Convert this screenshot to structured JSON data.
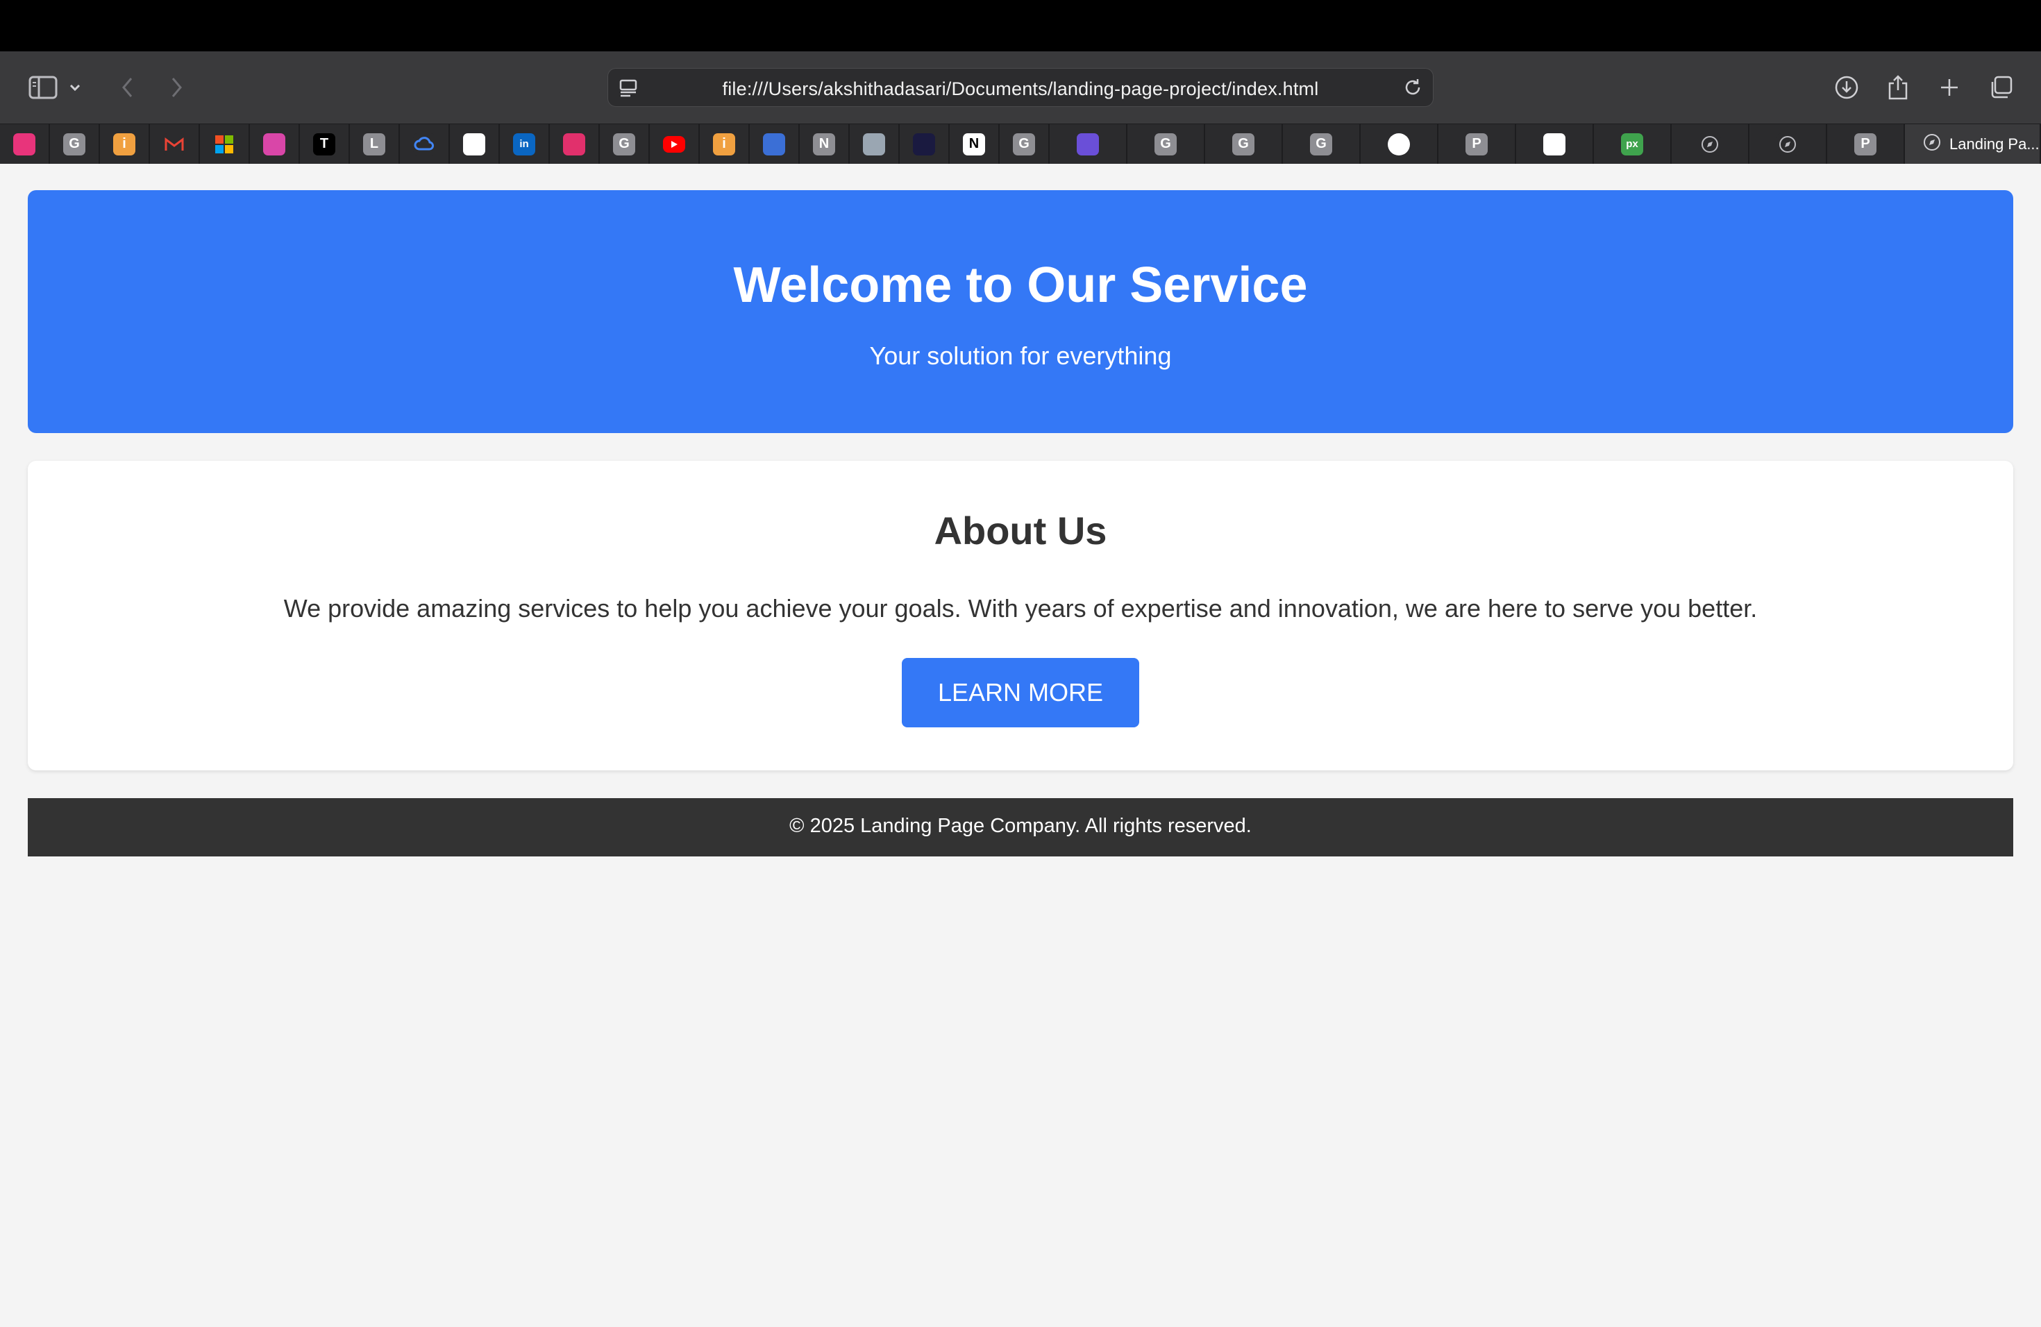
{
  "browser": {
    "address": "file:///Users/akshithadasari/Documents/landing-page-project/index.html",
    "active_tab_title": "Landing Pa...",
    "toolbar": {
      "sidebar_icon": "sidebar-icon",
      "back_icon": "chevron-left-icon",
      "forward_icon": "chevron-right-icon",
      "reload_icon": "reload-icon",
      "download_icon": "download-icon",
      "share_icon": "share-icon",
      "new_tab_icon": "plus-icon",
      "tab_overview_icon": "tab-overview-icon"
    },
    "tabs": [
      {
        "icon": "pink-gem-favicon",
        "letter": "",
        "color": "#e8347b"
      },
      {
        "icon": "generic-g-favicon",
        "letter": "G",
        "color": "#8e8e93"
      },
      {
        "icon": "orange-info-favicon",
        "letter": "i",
        "color": "#f0a040"
      },
      {
        "icon": "gmail-favicon",
        "letter": "M",
        "color": "#2b2b2d"
      },
      {
        "icon": "microsoft-favicon",
        "letter": "",
        "color": "#2b2b2d"
      },
      {
        "icon": "stairs-favicon",
        "letter": "",
        "color": "#d946a8"
      },
      {
        "icon": "t-circle-favicon",
        "letter": "T",
        "color": "#000000"
      },
      {
        "icon": "generic-l-favicon",
        "letter": "L",
        "color": "#8e8e93"
      },
      {
        "icon": "google-cloud-favicon",
        "letter": "",
        "color": "#2b2b2d"
      },
      {
        "icon": "puzzle-favicon",
        "letter": "",
        "color": "#ffffff"
      },
      {
        "icon": "linkedin-favicon",
        "letter": "in",
        "color": "#0a66c2"
      },
      {
        "icon": "instagram-favicon",
        "letter": "",
        "color": "#e1306c"
      },
      {
        "icon": "generic-g-favicon",
        "letter": "G",
        "color": "#8e8e93"
      },
      {
        "icon": "youtube-favicon",
        "letter": "",
        "color": "#ff0000"
      },
      {
        "icon": "orange-info-favicon",
        "letter": "i",
        "color": "#f0a040"
      },
      {
        "icon": "cube-favicon",
        "letter": "",
        "color": "#3b6fd6"
      },
      {
        "icon": "generic-n-favicon",
        "letter": "N",
        "color": "#8e8e93"
      },
      {
        "icon": "boot-favicon",
        "letter": "",
        "color": "#9aa6b2"
      },
      {
        "icon": "sparkle-favicon",
        "letter": "",
        "color": "#1a1a40"
      },
      {
        "icon": "notion-favicon",
        "letter": "N",
        "color": "#ffffff"
      },
      {
        "icon": "generic-g-favicon",
        "letter": "G",
        "color": "#8e8e93"
      },
      {
        "icon": "list-favicon",
        "letter": "",
        "color": "#6a4fd8"
      },
      {
        "icon": "generic-g-favicon",
        "letter": "G",
        "color": "#8e8e93"
      },
      {
        "icon": "generic-g-favicon",
        "letter": "G",
        "color": "#8e8e93"
      },
      {
        "icon": "generic-g-favicon",
        "letter": "G",
        "color": "#8e8e93"
      },
      {
        "icon": "github-favicon",
        "letter": "",
        "color": "#ffffff"
      },
      {
        "icon": "generic-p-favicon",
        "letter": "P",
        "color": "#8e8e93"
      },
      {
        "icon": "checker-favicon",
        "letter": "",
        "color": "#ffffff"
      },
      {
        "icon": "px-favicon",
        "letter": "px",
        "color": "#3fa34d"
      },
      {
        "icon": "compass-favicon",
        "letter": "",
        "color": "#2b2b2d"
      },
      {
        "icon": "compass-favicon",
        "letter": "",
        "color": "#2b2b2d"
      },
      {
        "icon": "generic-p-favicon",
        "letter": "P",
        "color": "#8e8e93"
      }
    ]
  },
  "page": {
    "hero": {
      "title": "Welcome to Our Service",
      "subtitle": "Your solution for everything"
    },
    "about": {
      "heading": "About Us",
      "text": "We provide amazing services to help you achieve your goals. With years of expertise and innovation, we are here to serve you better.",
      "button_label": "LEARN MORE"
    },
    "footer": {
      "text": "© 2025 Landing Page Company. All rights reserved."
    }
  },
  "colors": {
    "accent": "#3478f6",
    "footer_bg": "#333333",
    "page_bg": "#f4f4f4"
  }
}
